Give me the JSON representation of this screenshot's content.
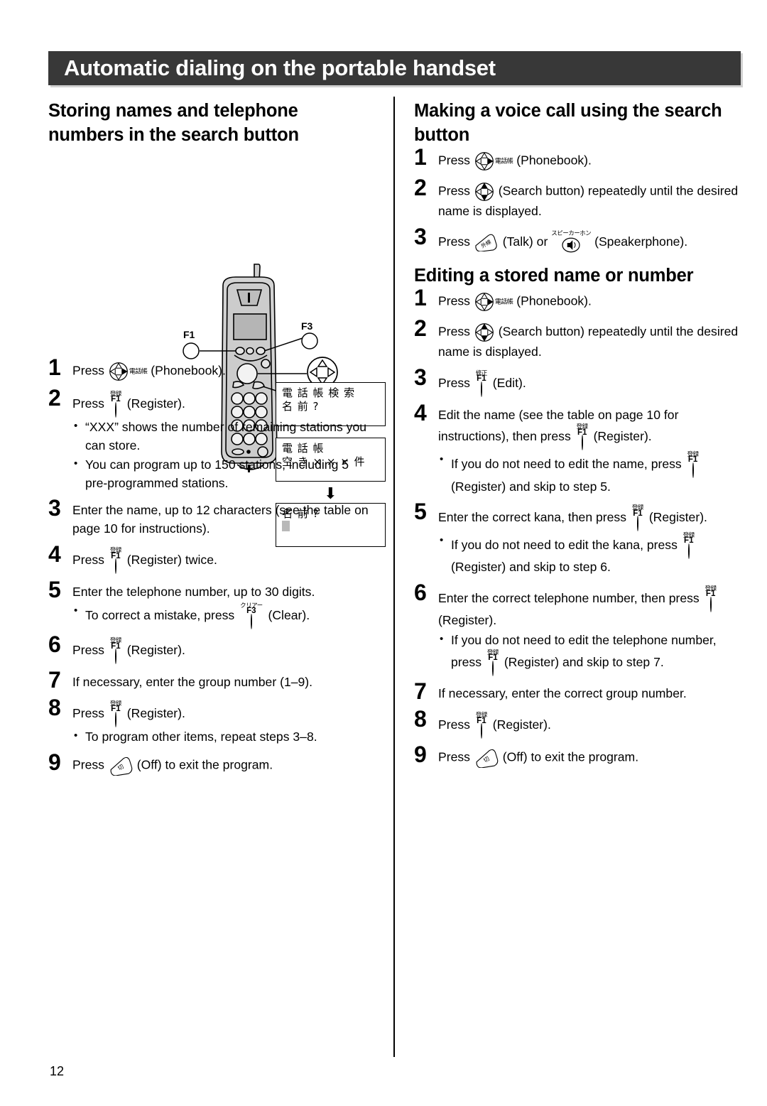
{
  "header": {
    "title": "Automatic dialing on the portable handset"
  },
  "page_number": "12",
  "icons": {
    "phonebook_jp": "電話帳",
    "speakerphone_jp": "スピーカーホン",
    "talk_jp": "外線",
    "off_jp": "切",
    "register_jp": "登録",
    "edit_jp": "修正",
    "clear_jp": "クリアー",
    "f1": "F1",
    "f3": "F3"
  },
  "handset": {
    "label_f1": "F1",
    "label_f3": "F3"
  },
  "displays": [
    {
      "line1": "電 話 帳 検 索",
      "line2": "名 前 ?"
    },
    {
      "line1": "電 話 帳",
      "line2": "空 き × × × 件"
    },
    {
      "line1": "名 前 ?",
      "line2": ""
    }
  ],
  "left": {
    "title": "Storing names and telephone numbers in the search button",
    "steps": [
      {
        "n": "1",
        "parts": [
          {
            "t": "text",
            "v": "Press "
          },
          {
            "t": "icon",
            "v": "phonebook"
          },
          {
            "t": "text",
            "v": " (Phonebook)."
          }
        ],
        "bullets": []
      },
      {
        "n": "2",
        "parts": [
          {
            "t": "text",
            "v": "Press "
          },
          {
            "t": "icon",
            "v": "f1-register"
          },
          {
            "t": "text",
            "v": " (Register)."
          }
        ],
        "bullets": [
          "“XXX” shows the number of remaining stations you can store.",
          "You can program up to 150 stations, including 5 pre-programmed stations."
        ]
      },
      {
        "n": "3",
        "parts": [
          {
            "t": "text",
            "v": "Enter the name, up to 12 characters (see the table on page 10 for instructions)."
          }
        ],
        "bullets": []
      },
      {
        "n": "4",
        "parts": [
          {
            "t": "text",
            "v": "Press "
          },
          {
            "t": "icon",
            "v": "f1-register"
          },
          {
            "t": "text",
            "v": " (Register) twice."
          }
        ],
        "bullets": []
      },
      {
        "n": "5",
        "parts": [
          {
            "t": "text",
            "v": "Enter the telephone number, up to 30 digits."
          }
        ],
        "bullets_rich": [
          [
            {
              "t": "text",
              "v": "To correct a mistake, press "
            },
            {
              "t": "icon",
              "v": "f3-clear"
            },
            {
              "t": "text",
              "v": " (Clear)."
            }
          ]
        ]
      },
      {
        "n": "6",
        "parts": [
          {
            "t": "text",
            "v": "Press "
          },
          {
            "t": "icon",
            "v": "f1-register"
          },
          {
            "t": "text",
            "v": " (Register)."
          }
        ],
        "bullets": []
      },
      {
        "n": "7",
        "parts": [
          {
            "t": "text",
            "v": "If necessary, enter the group number (1–9)."
          }
        ],
        "bullets": []
      },
      {
        "n": "8",
        "parts": [
          {
            "t": "text",
            "v": "Press "
          },
          {
            "t": "icon",
            "v": "f1-register"
          },
          {
            "t": "text",
            "v": " (Register)."
          }
        ],
        "bullets": [
          "To program other items, repeat steps 3–8."
        ]
      },
      {
        "n": "9",
        "parts": [
          {
            "t": "text",
            "v": "Press "
          },
          {
            "t": "icon",
            "v": "off"
          },
          {
            "t": "text",
            "v": " (Off) to exit the program."
          }
        ],
        "bullets": []
      }
    ]
  },
  "right": {
    "title_voice": "Making a voice call using the search button",
    "voice_steps": [
      {
        "n": "1",
        "parts": [
          {
            "t": "text",
            "v": "Press "
          },
          {
            "t": "icon",
            "v": "phonebook"
          },
          {
            "t": "text",
            "v": " (Phonebook)."
          }
        ]
      },
      {
        "n": "2",
        "parts": [
          {
            "t": "text",
            "v": "Press "
          },
          {
            "t": "icon",
            "v": "search"
          },
          {
            "t": "text",
            "v": " (Search button) repeatedly until the desired name is displayed."
          }
        ]
      },
      {
        "n": "3",
        "parts": [
          {
            "t": "text",
            "v": "Press "
          },
          {
            "t": "icon",
            "v": "talk"
          },
          {
            "t": "text",
            "v": " (Talk) or "
          },
          {
            "t": "icon",
            "v": "speakerphone"
          },
          {
            "t": "text",
            "v": " (Speakerphone)."
          }
        ]
      }
    ],
    "title_editing": "Editing a stored name or number",
    "editing_steps": [
      {
        "n": "1",
        "parts": [
          {
            "t": "text",
            "v": "Press "
          },
          {
            "t": "icon",
            "v": "phonebook"
          },
          {
            "t": "text",
            "v": " (Phonebook)."
          }
        ],
        "bullets_rich": []
      },
      {
        "n": "2",
        "parts": [
          {
            "t": "text",
            "v": "Press "
          },
          {
            "t": "icon",
            "v": "search"
          },
          {
            "t": "text",
            "v": " (Search button) repeatedly until the desired name is displayed."
          }
        ],
        "bullets_rich": []
      },
      {
        "n": "3",
        "parts": [
          {
            "t": "text",
            "v": "Press "
          },
          {
            "t": "icon",
            "v": "f1-edit"
          },
          {
            "t": "text",
            "v": " (Edit)."
          }
        ],
        "bullets_rich": []
      },
      {
        "n": "4",
        "parts": [
          {
            "t": "text",
            "v": "Edit the name (see the table on page 10 for instructions), then press "
          },
          {
            "t": "icon",
            "v": "f1-register"
          },
          {
            "t": "text",
            "v": " (Register)."
          }
        ],
        "bullets_rich": [
          [
            {
              "t": "text",
              "v": "If you do not need to edit the name, press "
            },
            {
              "t": "icon",
              "v": "f1-register"
            },
            {
              "t": "text",
              "v": " (Register) and skip to step 5."
            }
          ]
        ]
      },
      {
        "n": "5",
        "parts": [
          {
            "t": "text",
            "v": "Enter the correct kana, then press "
          },
          {
            "t": "icon",
            "v": "f1-register"
          },
          {
            "t": "text",
            "v": " (Register)."
          }
        ],
        "bullets_rich": [
          [
            {
              "t": "text",
              "v": "If you do not need to edit the kana, press "
            },
            {
              "t": "icon",
              "v": "f1-register"
            },
            {
              "t": "text",
              "v": " (Register) and skip to step 6."
            }
          ]
        ]
      },
      {
        "n": "6",
        "parts": [
          {
            "t": "text",
            "v": "Enter the correct telephone number, then press "
          },
          {
            "t": "icon",
            "v": "f1-register"
          },
          {
            "t": "text",
            "v": " (Register)."
          }
        ],
        "bullets_rich": [
          [
            {
              "t": "text",
              "v": "If you do not need to edit the telephone number, press "
            },
            {
              "t": "icon",
              "v": "f1-register"
            },
            {
              "t": "text",
              "v": " (Register) and skip to step 7."
            }
          ]
        ]
      },
      {
        "n": "7",
        "parts": [
          {
            "t": "text",
            "v": "If necessary, enter the correct group number."
          }
        ],
        "bullets_rich": []
      },
      {
        "n": "8",
        "parts": [
          {
            "t": "text",
            "v": "Press "
          },
          {
            "t": "icon",
            "v": "f1-register"
          },
          {
            "t": "text",
            "v": " (Register)."
          }
        ],
        "bullets_rich": []
      },
      {
        "n": "9",
        "parts": [
          {
            "t": "text",
            "v": "Press "
          },
          {
            "t": "icon",
            "v": "off"
          },
          {
            "t": "text",
            "v": " (Off) to exit the program."
          }
        ],
        "bullets_rich": []
      }
    ]
  }
}
